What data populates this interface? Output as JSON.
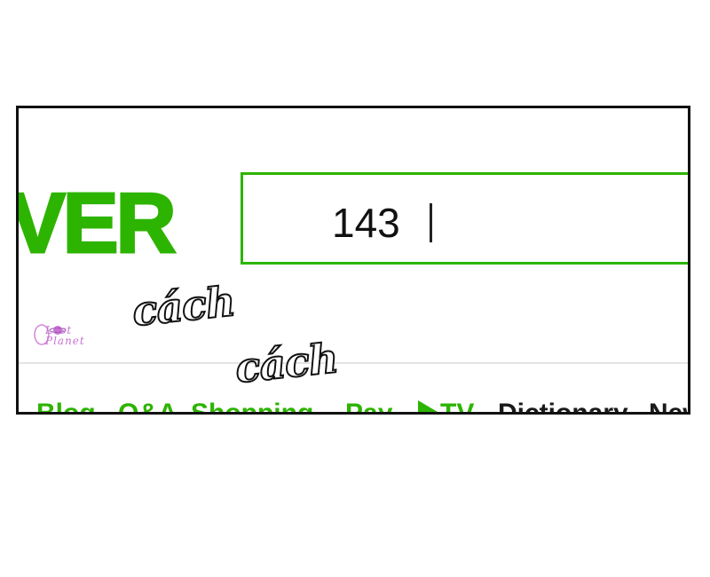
{
  "logo": {
    "text": "VER",
    "color": "#2db400"
  },
  "search": {
    "value": "143",
    "border_color": "#2db400"
  },
  "nav": {
    "items": [
      {
        "label": "Blog",
        "color": "#2db400"
      },
      {
        "label": "Q&A",
        "color": "#2db400"
      },
      {
        "label": "Shopping",
        "color": "#2db400"
      },
      {
        "label": "Pay",
        "color": "#2db400"
      },
      {
        "label": "TV",
        "icon": "play-icon",
        "color": "#2db400"
      },
      {
        "label": "Dictionary",
        "color": "#1a1a1a"
      },
      {
        "label": "New",
        "color": "#1a1a1a"
      }
    ]
  },
  "overlay": {
    "sfx_1": "cách",
    "sfx_2": "cách",
    "watermark": "Lost Planet"
  }
}
